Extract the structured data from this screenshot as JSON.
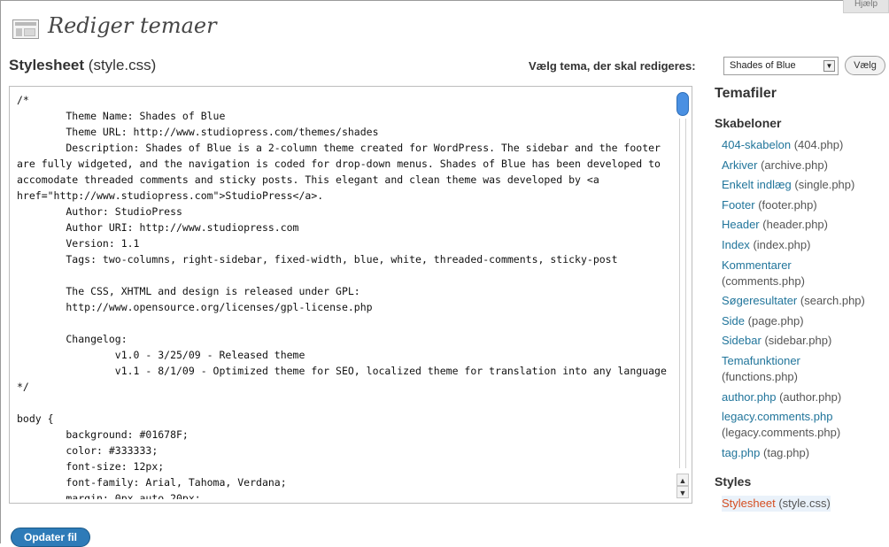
{
  "help_tab": "Hjælp",
  "page_title": "Rediger temaer",
  "file_heading": {
    "title": "Stylesheet",
    "filename": "(style.css)"
  },
  "theme_select": {
    "label": "Vælg tema, der skal redigeres:",
    "selected": "Shades of Blue",
    "button": "Vælg"
  },
  "editor": {
    "lines": [
      "/*",
      "        Theme Name: Shades of Blue",
      "        Theme URL: http://www.studiopress.com/themes/shades",
      "        Description: Shades of Blue is a 2-column theme created for WordPress. The sidebar and the footer",
      "are fully widgeted, and the navigation is coded for drop-down menus. Shades of Blue has been developed to",
      "accomodate threaded comments and sticky posts. This elegant and clean theme was developed by <a",
      "href=\"http://www.studiopress.com\">StudioPress</a>.",
      "        Author: StudioPress",
      "        Author URI: http://www.studiopress.com",
      "        Version: 1.1",
      "        Tags: two-columns, right-sidebar, fixed-width, blue, white, threaded-comments, sticky-post",
      "",
      "        The CSS, XHTML and design is released under GPL:",
      "        http://www.opensource.org/licenses/gpl-license.php",
      "",
      "        Changelog:",
      "                v1.0 - 3/25/09 - Released theme",
      "                v1.1 - 8/1/09 - Optimized theme for SEO, localized theme for translation into any language",
      "*/",
      "",
      "body {",
      "        background: #01678F;",
      "        color: #333333;",
      "        font-size: 12px;",
      "        font-family: Arial, Tahoma, Verdana;",
      "        margin: 0px auto 20px;"
    ]
  },
  "sidebar": {
    "title": "Temafiler",
    "templates_heading": "Skabeloner",
    "templates": [
      {
        "name": "404-skabelon",
        "file": "(404.php)"
      },
      {
        "name": "Arkiver",
        "file": "(archive.php)"
      },
      {
        "name": "Enkelt indlæg",
        "file": "(single.php)"
      },
      {
        "name": "Footer",
        "file": "(footer.php)"
      },
      {
        "name": "Header",
        "file": "(header.php)"
      },
      {
        "name": "Index",
        "file": "(index.php)"
      },
      {
        "name": "Kommentarer",
        "file": "(comments.php)"
      },
      {
        "name": "Søgeresultater",
        "file": "(search.php)"
      },
      {
        "name": "Side",
        "file": "(page.php)"
      },
      {
        "name": "Sidebar",
        "file": "(sidebar.php)"
      },
      {
        "name": "Temafunktioner",
        "file": "(functions.php)"
      },
      {
        "name": "author.php",
        "file": "(author.php)"
      },
      {
        "name": "legacy.comments.php",
        "file": "(legacy.comments.php)"
      },
      {
        "name": "tag.php",
        "file": "(tag.php)"
      }
    ],
    "styles_heading": "Styles",
    "styles": [
      {
        "name": "Stylesheet",
        "file": "(style.css)",
        "active": true
      }
    ]
  },
  "update_button": "Opdater fil"
}
